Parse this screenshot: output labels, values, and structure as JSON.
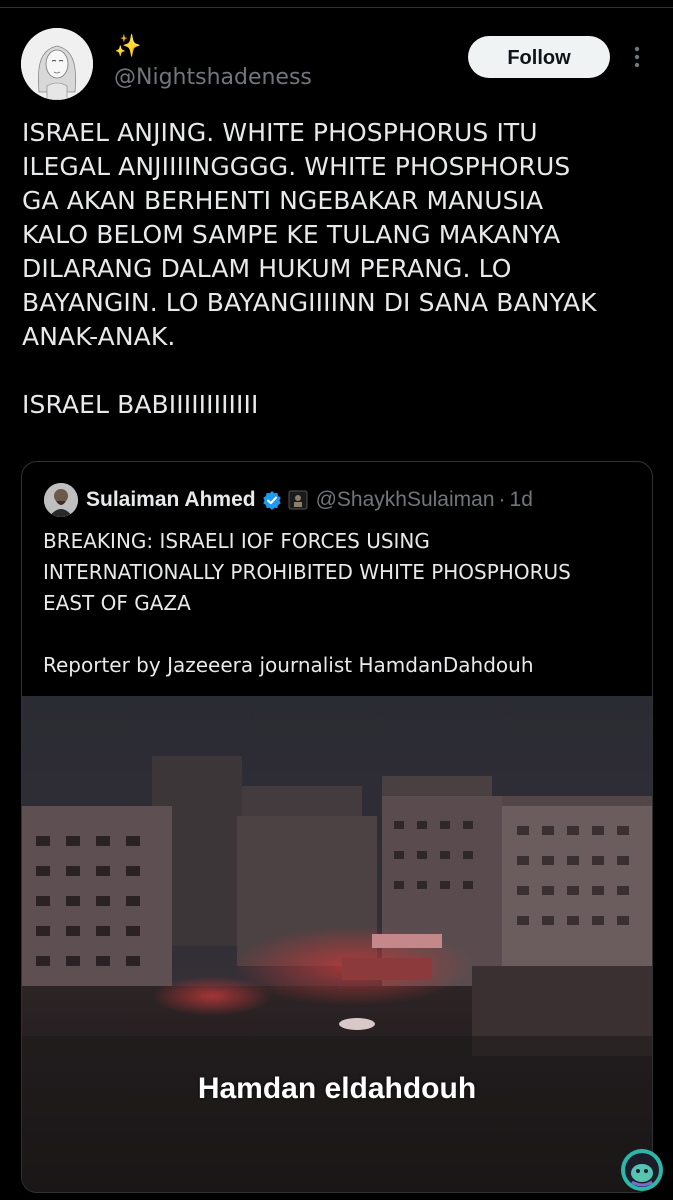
{
  "post": {
    "display_name": "✨",
    "handle": "@Nightshadeness",
    "follow_label": "Follow",
    "text": "ISRAEL ANJING. WHITE PHOSPHORUS ITU\nILEGAL ANJIIIINGGGG. WHITE PHOSPHORUS\nGA AKAN BERHENTI NGEBAKAR MANUSIA\nKALO BELOM SAMPE KE TULANG MAKANYA\nDILARANG DALAM HUKUM PERANG. LO\nBAYANGIN. LO BAYANGIIIINN DI SANA BANYAK\nANAK-ANAK.\n\nISRAEL BABIIIIIIIIIIII"
  },
  "quote": {
    "name": "Sulaiman Ahmed",
    "handle": "@ShaykhSulaiman",
    "separator": "·",
    "time": "1d",
    "text": "BREAKING: ISRAELI IOF FORCES USING\nINTERNATIONALLY PROHIBITED WHITE PHOSPHORUS\nEAST OF GAZA\n\nReporter by Jazeeera journalist HamdanDahdouh",
    "video_caption": "Hamdan eldahdouh"
  },
  "icons": {
    "verified": "verified-badge-icon",
    "affiliate": "affiliate-badge-icon",
    "more": "more-vertical-icon",
    "badge": "app-badge-icon"
  },
  "colors": {
    "background": "#000000",
    "text": "#e7e9ea",
    "muted": "#71767b",
    "border": "#2f3336",
    "verified": "#1d9bf0",
    "follow_bg": "#eff3f4"
  }
}
